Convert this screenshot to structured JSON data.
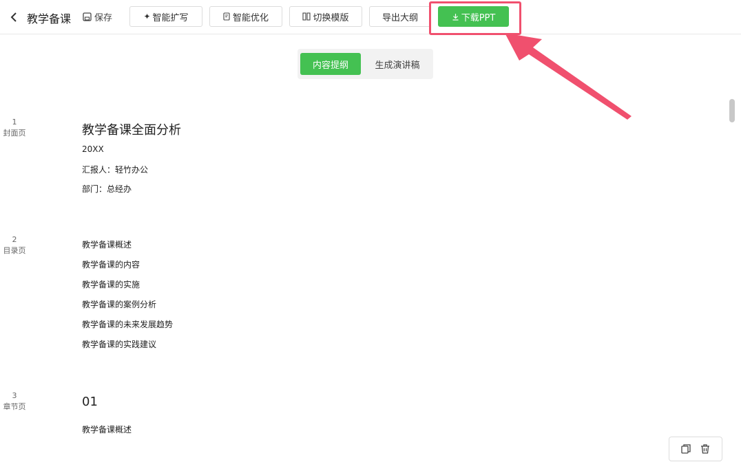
{
  "header": {
    "title": "教学备课",
    "save_label": "保存",
    "buttons": {
      "expand": "智能扩写",
      "optimize": "智能优化",
      "template": "切换模版",
      "outline": "导出大纲",
      "download": "下载PPT"
    }
  },
  "tabs": {
    "outline": "内容提纲",
    "speech": "生成演讲稿"
  },
  "slides": [
    {
      "number": "1",
      "type": "封面页",
      "title": "教学备课全面分析",
      "lines": [
        "20XX",
        "汇报人：轻竹办公",
        "部门：总经办"
      ]
    },
    {
      "number": "2",
      "type": "目录页",
      "lines": [
        "教学备课概述",
        "教学备课的内容",
        "教学备课的实施",
        "教学备课的案例分析",
        "教学备课的未来发展趋势",
        "教学备课的实践建议"
      ]
    },
    {
      "number": "3",
      "type": "章节页",
      "title": "01",
      "lines": [
        "教学备课概述"
      ]
    }
  ],
  "colors": {
    "accent": "#44c152",
    "highlight": "#f0506e"
  }
}
